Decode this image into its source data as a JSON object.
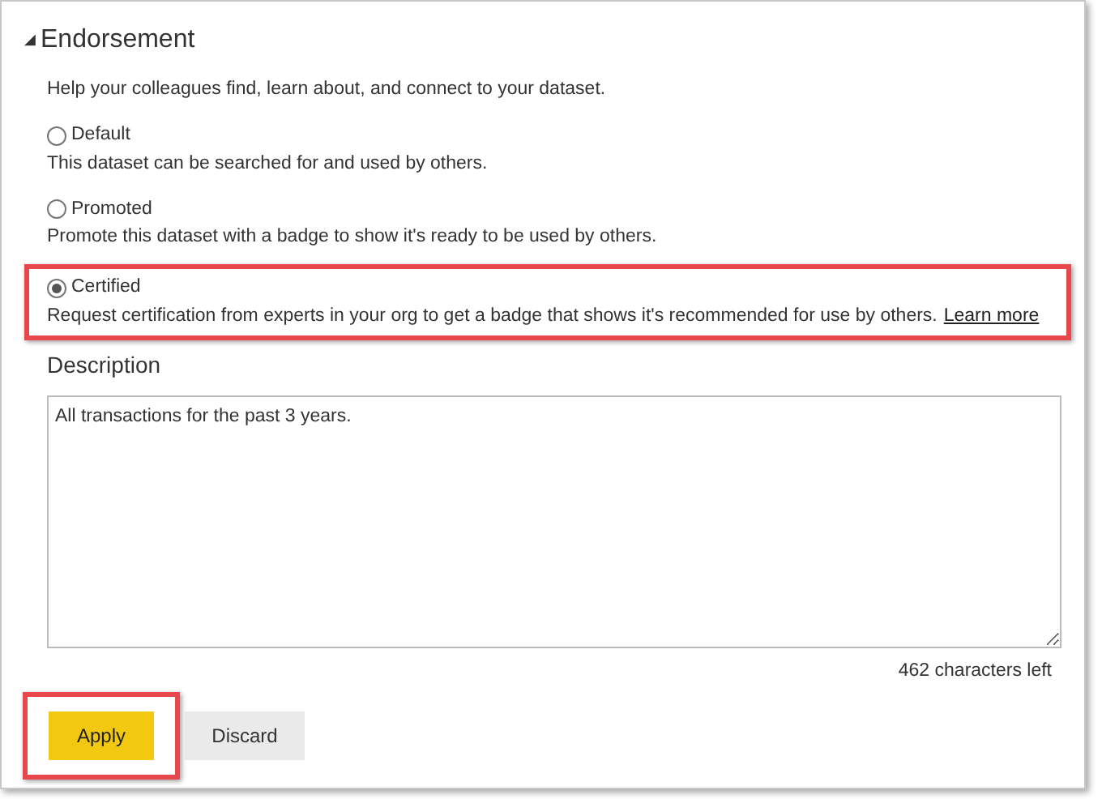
{
  "section": {
    "toggle": "◢",
    "title": "Endorsement",
    "expanded": true
  },
  "intro": "Help your colleagues find, learn about, and connect to your dataset.",
  "options": [
    {
      "label": "Default",
      "description": "This dataset can be searched for and used by others.",
      "selected": false,
      "highlighted": false
    },
    {
      "label": "Promoted",
      "description": "Promote this dataset with a badge to show it's ready to be used by others.",
      "selected": false,
      "highlighted": false
    },
    {
      "label": "Certified",
      "description": "Request certification from experts in your org to get a badge that shows it's recommended for use by others.",
      "link": "Learn more",
      "selected": true,
      "highlighted": true
    }
  ],
  "description": {
    "label": "Description",
    "value": "All transactions for the past 3 years.",
    "counter": "462 characters left"
  },
  "buttons": [
    {
      "label": "Apply",
      "kind": "primary",
      "highlighted": true
    },
    {
      "label": "Discard",
      "kind": "secondary",
      "highlighted": false
    }
  ]
}
